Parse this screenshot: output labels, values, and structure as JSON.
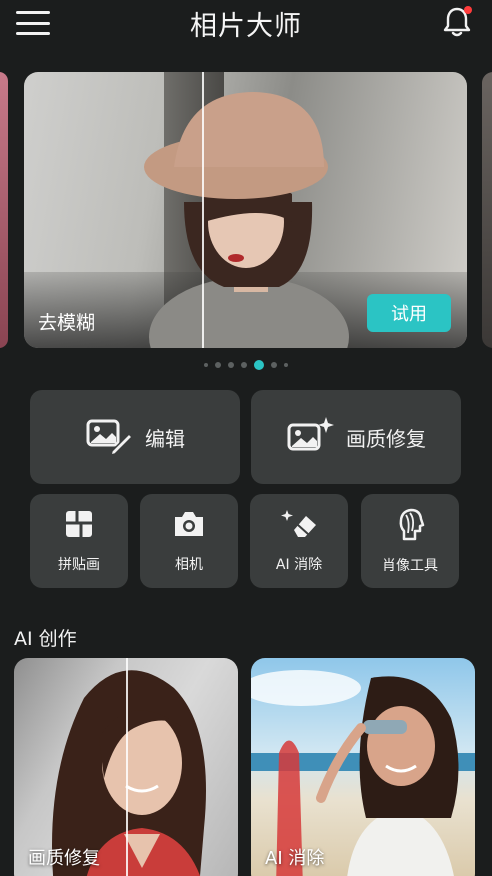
{
  "header": {
    "title": "相片大师",
    "menu_icon": "hamburger-menu-icon",
    "bell_icon": "bell-icon",
    "notification_color": "#ff3b3b"
  },
  "banner": {
    "label": "去模糊",
    "try_button": "试用",
    "accent": "#2bc4c4",
    "page_count": 7,
    "active_index": 4
  },
  "tools": {
    "edit": {
      "label": "编辑",
      "icon": "image-edit-icon"
    },
    "enhance": {
      "label": "画质修复",
      "icon": "image-sparkle-icon"
    },
    "collage": {
      "label": "拼贴画",
      "icon": "collage-grid-icon"
    },
    "camera": {
      "label": "相机",
      "icon": "camera-icon"
    },
    "ai_erase": {
      "label": "AI 消除",
      "icon": "eraser-sparkle-icon"
    },
    "portrait": {
      "label": "肖像工具",
      "icon": "portrait-profile-icon"
    }
  },
  "ai_section": {
    "title": "AI 创作",
    "cards": [
      {
        "label": "画质修复"
      },
      {
        "label": "AI 消除"
      }
    ]
  }
}
